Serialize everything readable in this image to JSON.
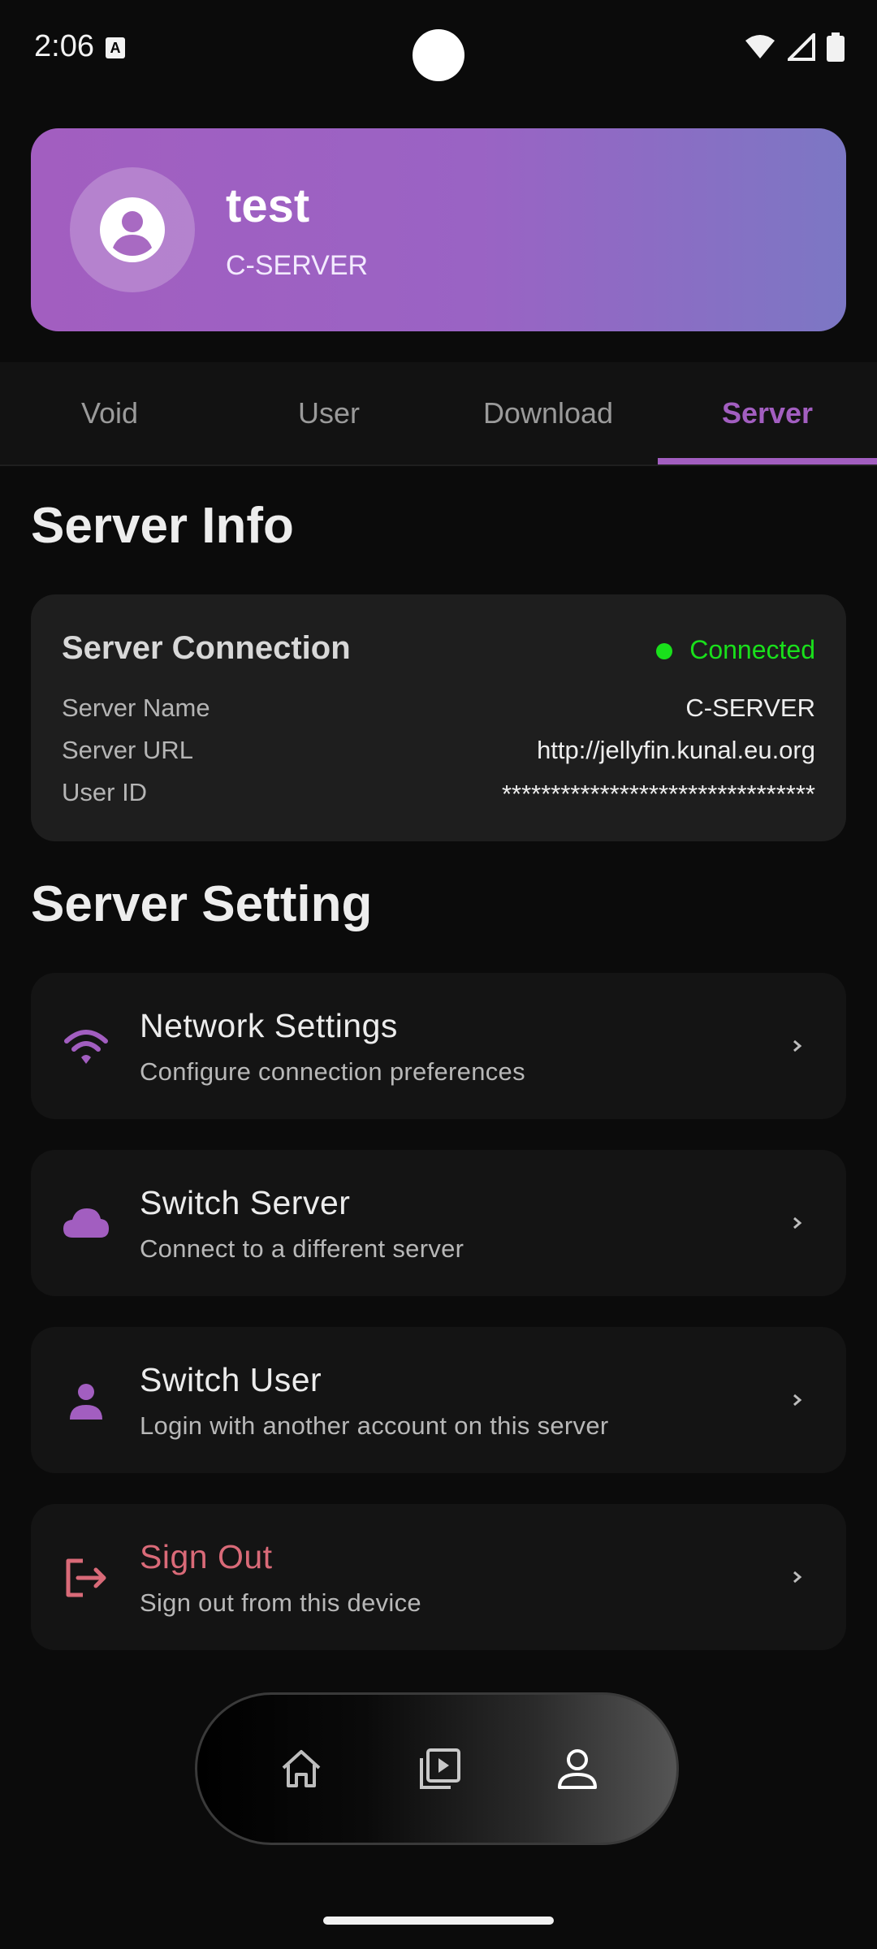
{
  "status_bar": {
    "time": "2:06",
    "indicator_letter": "A"
  },
  "profile": {
    "name": "test",
    "server": "C-SERVER"
  },
  "tabs": [
    {
      "label": "Void"
    },
    {
      "label": "User"
    },
    {
      "label": "Download"
    },
    {
      "label": "Server"
    }
  ],
  "active_tab": "Server",
  "server_info": {
    "heading": "Server Info",
    "card_title": "Server Connection",
    "status": "Connected",
    "status_color": "#19e01b",
    "rows": [
      {
        "label": "Server Name",
        "value": "C-SERVER"
      },
      {
        "label": "Server URL",
        "value": "http://jellyfin.kunal.eu.org"
      },
      {
        "label": "User ID",
        "value": "********************************"
      }
    ]
  },
  "server_setting": {
    "heading": "Server Setting",
    "items": [
      {
        "title": "Network Settings",
        "subtitle": "Configure connection preferences",
        "icon": "wifi-icon"
      },
      {
        "title": "Switch Server",
        "subtitle": "Connect to a different server",
        "icon": "cloud-icon"
      },
      {
        "title": "Switch User",
        "subtitle": "Login with another account on this server",
        "icon": "person-icon"
      },
      {
        "title": "Sign Out",
        "subtitle": "Sign out from this device",
        "icon": "logout-icon"
      }
    ]
  },
  "bottom_nav": [
    {
      "icon": "home-icon"
    },
    {
      "icon": "library-icon"
    },
    {
      "icon": "profile-icon"
    }
  ],
  "colors": {
    "accent": "#a25ec0",
    "danger": "#d96a78",
    "background": "#0b0b0b"
  }
}
